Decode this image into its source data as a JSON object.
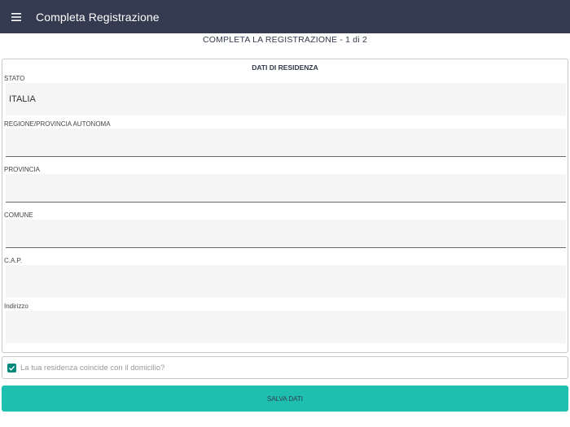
{
  "appbar": {
    "title": "Completa Registrazione"
  },
  "page": {
    "step_title": "COMPLETA LA REGISTRAZIONE - 1 di 2"
  },
  "residence": {
    "section_title": "DATI DI RESIDENZA",
    "fields": [
      {
        "label": "STATO",
        "value": "ITALIA"
      },
      {
        "label": "REGIONE/PROVINCIA AUTONOMA",
        "value": ""
      },
      {
        "label": "PROVINCIA",
        "value": ""
      },
      {
        "label": "COMUNE",
        "value": ""
      },
      {
        "label": "C.A.P.",
        "value": ""
      },
      {
        "label": "Indirizzo",
        "value": ""
      }
    ]
  },
  "domicile_checkbox": {
    "label": "La tua residenza coincide con il domicilio?",
    "checked": true
  },
  "actions": {
    "save_label": "SALVA DATI"
  },
  "colors": {
    "appbar": "#343a4f",
    "accent": "#1fbfb0",
    "checkbox": "#00897b"
  },
  "icons": {
    "menu": "hamburger-menu-icon",
    "check": "check-icon"
  }
}
